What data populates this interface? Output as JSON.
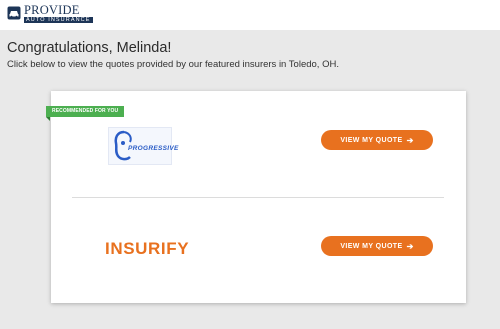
{
  "header": {
    "logo_main": "PROVIDE",
    "logo_sub": "AUTO INSURANCE"
  },
  "headline": "Congratulations, Melinda!",
  "subline": "Click below to view the quotes provided by our featured insurers in Toledo, OH.",
  "offers": [
    {
      "ribbon": "RECOMMENDED FOR YOU",
      "insurer": "PROGRESSIVE",
      "button_label": "VIEW MY QUOTE"
    },
    {
      "insurer": "INSURIFY",
      "button_label": "VIEW MY QUOTE"
    }
  ],
  "colors": {
    "accent": "#e8711f",
    "ribbon": "#4caf50",
    "brand": "#1d3557",
    "progressive": "#2a5cc6"
  }
}
